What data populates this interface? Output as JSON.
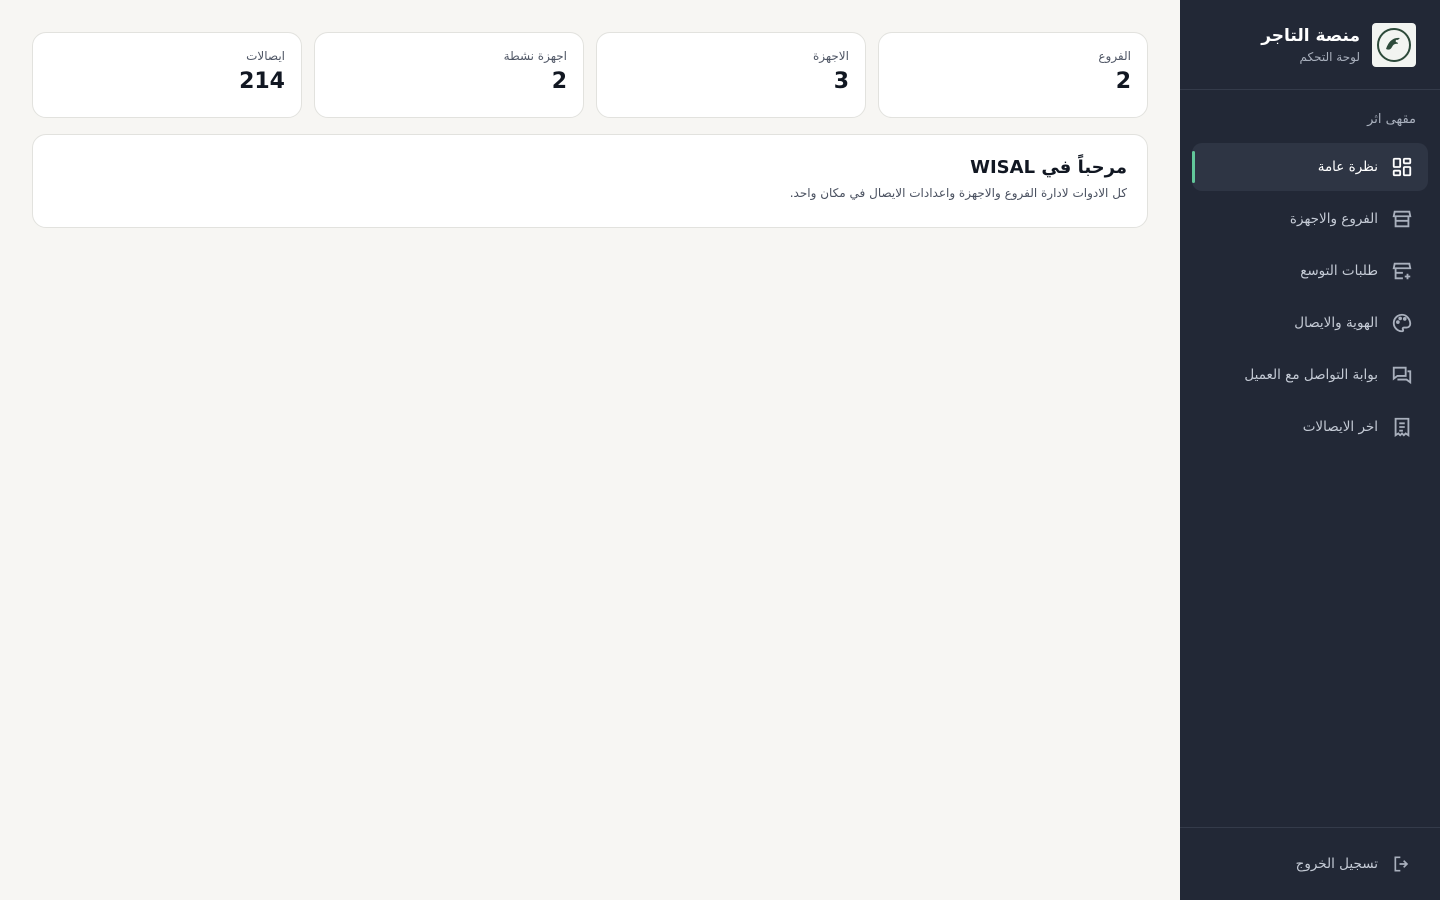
{
  "sidebar": {
    "title": "منصة التاجر",
    "subtitle": "لوحة التحكم",
    "store_name": "مقهى اثر",
    "items": [
      {
        "label": "نظرة عامة",
        "icon": "dashboard-icon"
      },
      {
        "label": "الفروع والاجهزة",
        "icon": "store-icon"
      },
      {
        "label": "طلبات التوسع",
        "icon": "add-store-icon"
      },
      {
        "label": "الهوية والايصال",
        "icon": "palette-icon"
      },
      {
        "label": "بوابة التواصل مع العميل",
        "icon": "chat-icon"
      },
      {
        "label": "اخر الايصالات",
        "icon": "receipt-icon"
      }
    ],
    "logout_label": "تسجيل الخروج",
    "accent_color": "#62c79a"
  },
  "stats": [
    {
      "label": "الفروع",
      "value": "2"
    },
    {
      "label": "الاجهزة",
      "value": "3"
    },
    {
      "label": "اجهزة نشطة",
      "value": "2"
    },
    {
      "label": "ايصالات",
      "value": "214"
    }
  ],
  "welcome": {
    "title": "مرحباً في WISAL",
    "text": "كل الادوات لادارة الفروع والاجهزة واعدادات الايصال في مكان واحد."
  }
}
